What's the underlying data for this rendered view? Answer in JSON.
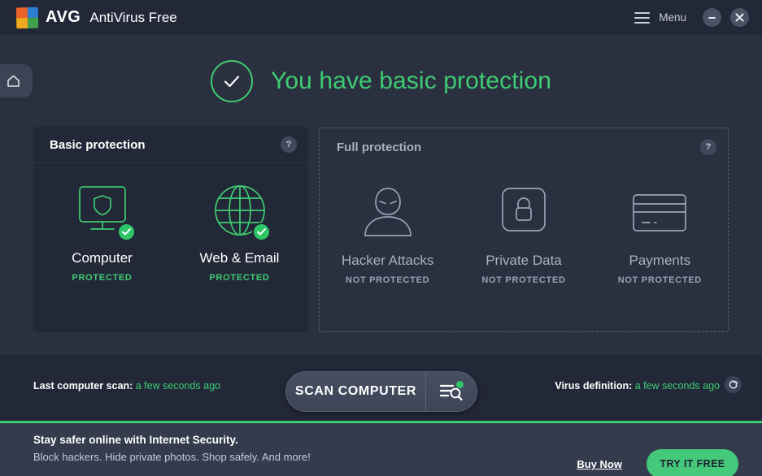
{
  "window": {
    "brand_mark": "AVG",
    "product_name": "AntiVirus Free",
    "logo_icon": "avg-logo-icon",
    "menu_icon": "hamburger-menu-icon",
    "menu_label": "Menu",
    "minimize_icon": "minimize-icon",
    "close_icon": "close-icon",
    "home_tab_icon": "home-icon"
  },
  "status": {
    "icon": "check-circle-icon",
    "headline": "You have basic protection",
    "accent_color": "#3ecb71"
  },
  "basic_panel": {
    "title": "Basic protection",
    "help_label": "?",
    "tiles": [
      {
        "icon": "computer-shield-icon",
        "name": "Computer",
        "state": "PROTECTED",
        "badge_icon": "check-badge-icon"
      },
      {
        "icon": "globe-icon",
        "name": "Web & Email",
        "state": "PROTECTED",
        "badge_icon": "check-badge-icon"
      }
    ]
  },
  "full_panel": {
    "title": "Full protection",
    "help_label": "?",
    "tiles": [
      {
        "icon": "hacker-person-icon",
        "name": "Hacker Attacks",
        "state": "NOT PROTECTED"
      },
      {
        "icon": "padlock-icon",
        "name": "Private Data",
        "state": "NOT PROTECTED"
      },
      {
        "icon": "credit-card-icon",
        "name": "Payments",
        "state": "NOT PROTECTED"
      }
    ]
  },
  "statusbar": {
    "last_scan_label": "Last computer scan:",
    "last_scan_value": "a few seconds ago",
    "virus_def_label": "Virus definition:",
    "virus_def_value": "a few seconds ago",
    "refresh_icon": "refresh-icon",
    "scan_button_label": "SCAN COMPUTER",
    "scan_button_icon": "scan-list-search-icon"
  },
  "promo": {
    "title": "Stay safer online with Internet Security.",
    "subtitle": "Block hackers. Hide private photos. Shop safely. And more!",
    "buy_now_label": "Buy Now",
    "try_free_label": "TRY IT FREE",
    "accent_color": "#44c97a"
  }
}
